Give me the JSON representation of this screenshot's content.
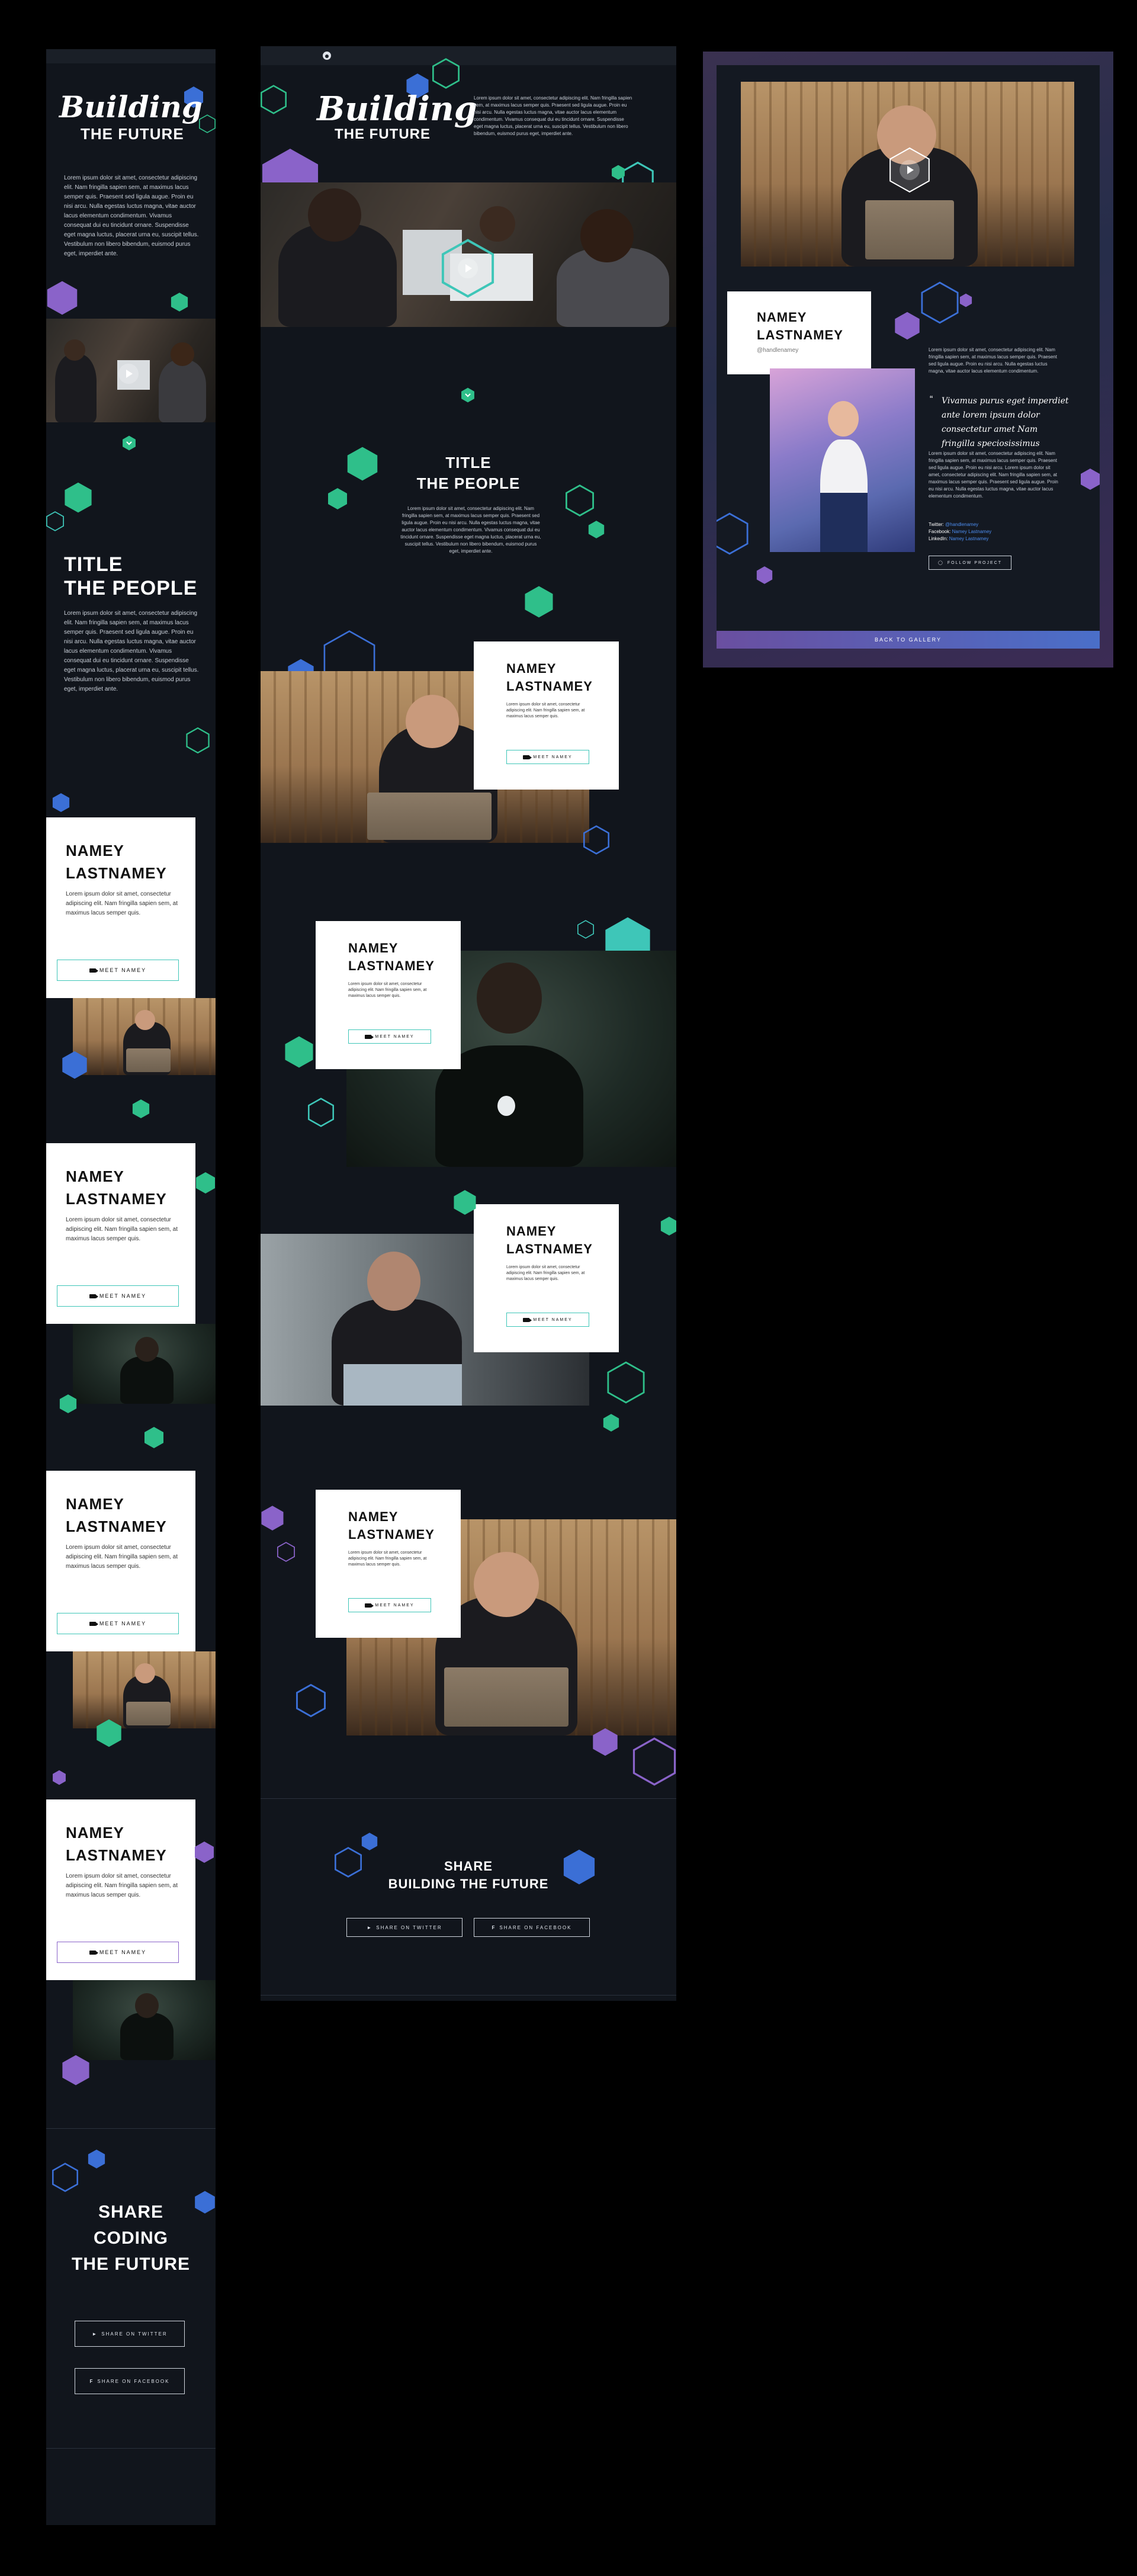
{
  "hero": {
    "title_script": "Building",
    "title_sub": "THE FUTURE",
    "intro": "Lorem ipsum dolor sit amet, consectetur adipiscing elit. Nam fringilla sapien sem, at maximus lacus semper quis. Praesent sed ligula augue. Proin eu nisi arcu. Nulla egestas luctus magna, vitae auctor lacus elementum condimentum. Vivamus consequat dui eu tincidunt ornare. Suspendisse eget magna luctus, placerat urna eu, suscipit tellus. Vestibulum non libero bibendum, euismod purus eget, imperdiet ante."
  },
  "people_section": {
    "title_line1": "TITLE",
    "title_line2": "THE PEOPLE",
    "body": "Lorem ipsum dolor sit amet, consectetur adipiscing elit. Nam fringilla sapien sem, at maximus lacus semper quis. Praesent sed ligula augue. Proin eu nisi arcu. Nulla egestas luctus magna, vitae auctor lacus elementum condimentum. Vivamus consequat dui eu tincidunt ornare. Suspendisse eget magna luctus, placerat urna eu, suscipit tellus. Vestibulum non libero bibendum, euismod purus eget, imperdiet ante."
  },
  "person": {
    "first": "NAMEY",
    "last": "LASTNAMEY",
    "desc": "Lorem ipsum dolor sit amet, consectetur adipiscing elit. Nam fringilla sapien sem, at maximus lacus semper quis.",
    "button": "MEET NAMEY"
  },
  "share": {
    "mobile_line1": "SHARE",
    "mobile_line2": "CODING",
    "mobile_line3": "THE FUTURE",
    "desktop_line1": "SHARE",
    "desktop_line2": "BUILDING THE FUTURE",
    "twitter": "SHARE ON TWITTER",
    "facebook": "SHARE ON FACEBOOK"
  },
  "modal": {
    "name_first": "NAMEY",
    "name_last": "LASTNAMEY",
    "handle": "@handlenamey",
    "bio1": "Lorem ipsum dolor sit amet, consectetur adipiscing elit. Nam fringilla sapien sem, at maximus lacus semper quis. Praesent sed ligula augue. Proin eu nisi arcu. Nulla egestas luctus magna, vitae auctor lacus elementum condimentum.",
    "quote": "Vivamus purus eget imperdiet ante lorem ipsum dolor consectetur amet Nam fringilla speciosissimus",
    "bio2": "Lorem ipsum dolor sit amet, consectetur adipiscing elit. Nam fringilla sapien sem, at maximus lacus semper quis. Praesent sed ligula augue. Proin eu nisi arcu. Lorem ipsum dolor sit amet, consectetur adipiscing elit. Nam fringilla sapien sem, at maximus lacus semper quis. Praesent sed ligula augue. Proin eu nisi arcu. Nulla egestas luctus magna, vitae auctor lacus elementum condimentum.",
    "twitter_label": "Twitter:",
    "twitter_value": "@handlenamey",
    "facebook_label": "Facebook:",
    "facebook_value": "Namey Lastnamey",
    "linkedin_label": "LinkedIn:",
    "linkedin_value": "Namey Lastnamey",
    "follow": "FOLLOW PROJECT",
    "back": "BACK TO GALLERY"
  },
  "colors": {
    "background": "#000000",
    "panel": "#11151c",
    "teal": "#3ec6b8",
    "green": "#2fbf8a",
    "blue": "#3b6fd6",
    "purple": "#8a63c9",
    "link": "#4c8df0"
  },
  "icons": [
    "github-icon",
    "play-icon",
    "video-camera-icon",
    "twitter-icon",
    "facebook-icon",
    "hexagon-icon",
    "chevron-down-icon"
  ]
}
